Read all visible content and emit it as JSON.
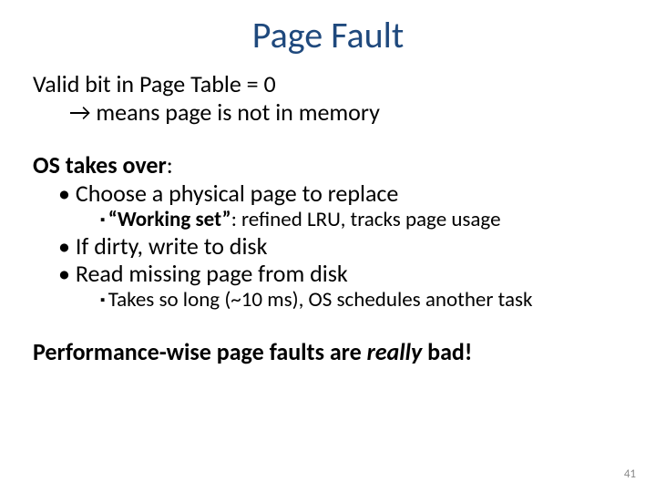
{
  "title": "Page Fault",
  "line1": "Valid bit in Page Table = 0",
  "line2": "→ means page is not in memory",
  "os_takes_over": "OS takes over",
  "colon": ":",
  "b1": "Choose a physical page to replace",
  "s1_strong": "“Working set”",
  "s1_rest": ": refined LRU, tracks page usage",
  "b2": "If dirty, write to disk",
  "b3": "Read missing page from disk",
  "s2": "Takes so long (~10 ms), OS schedules another task",
  "perf_a": "Performance-wise page faults are ",
  "perf_b": "really",
  "perf_c": " bad!",
  "pagenum": "41"
}
